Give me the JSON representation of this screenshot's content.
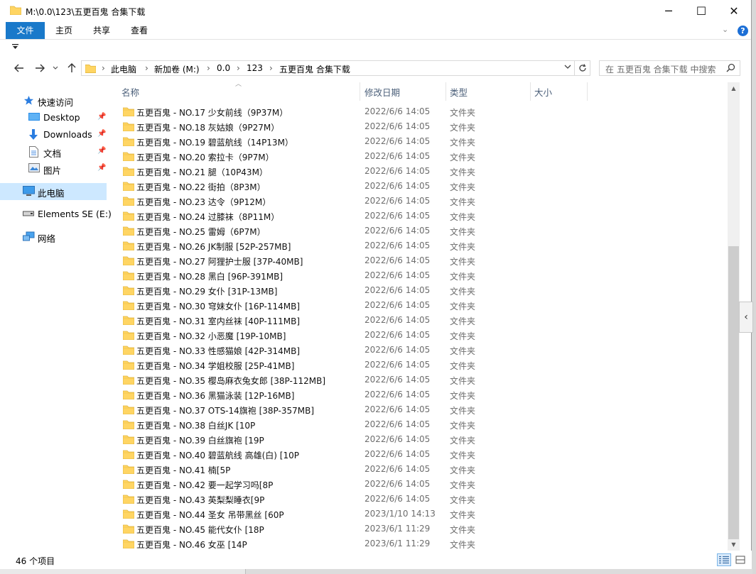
{
  "window": {
    "title": "M:\\0.0\\123\\五更百鬼 合集下载",
    "minimize_label": "─",
    "maximize_label": "☐",
    "close_label": "✕"
  },
  "ribbon": {
    "tabs": [
      "文件",
      "主页",
      "共享",
      "查看"
    ],
    "help_label": "?",
    "expand_label": "⌄"
  },
  "address": {
    "crumbs": [
      "此电脑",
      "新加卷 (M:)",
      "0.0",
      "123",
      "五更百鬼 合集下载"
    ],
    "search_placeholder": "在 五更百鬼 合集下载 中搜索"
  },
  "nav": {
    "quick_access": "快速访问",
    "items": [
      {
        "label": "Desktop",
        "pinned": true
      },
      {
        "label": "Downloads",
        "pinned": true
      },
      {
        "label": "文档",
        "pinned": true
      },
      {
        "label": "图片",
        "pinned": true
      }
    ],
    "this_pc": "此电脑",
    "drive": "Elements SE (E:)",
    "network": "网络"
  },
  "columns": {
    "name": "名称",
    "date": "修改日期",
    "type": "类型",
    "size": "大小"
  },
  "files": [
    {
      "name": "五更百鬼 - NO.17 少女前线（9P37M）",
      "date": "2022/6/6 14:05",
      "type": "文件夹"
    },
    {
      "name": "五更百鬼 - NO.18 灰姑娘（9P27M）",
      "date": "2022/6/6 14:05",
      "type": "文件夹"
    },
    {
      "name": "五更百鬼 - NO.19 碧蓝航线（14P13M）",
      "date": "2022/6/6 14:05",
      "type": "文件夹"
    },
    {
      "name": "五更百鬼 - NO.20 索拉卡（9P7M）",
      "date": "2022/6/6 14:05",
      "type": "文件夹"
    },
    {
      "name": "五更百鬼 - NO.21 腿（10P43M）",
      "date": "2022/6/6 14:05",
      "type": "文件夹"
    },
    {
      "name": "五更百鬼 - NO.22 街拍（8P3M）",
      "date": "2022/6/6 14:05",
      "type": "文件夹"
    },
    {
      "name": "五更百鬼 - NO.23 达令（9P12M）",
      "date": "2022/6/6 14:05",
      "type": "文件夹"
    },
    {
      "name": "五更百鬼 - NO.24 过膝袜（8P11M）",
      "date": "2022/6/6 14:05",
      "type": "文件夹"
    },
    {
      "name": "五更百鬼 - NO.25 雷姆（6P7M）",
      "date": "2022/6/6 14:05",
      "type": "文件夹"
    },
    {
      "name": "五更百鬼 - NO.26 JK制服 [52P-257MB]",
      "date": "2022/6/6 14:05",
      "type": "文件夹"
    },
    {
      "name": "五更百鬼 - NO.27 阿狸护士服 [37P-40MB]",
      "date": "2022/6/6 14:05",
      "type": "文件夹"
    },
    {
      "name": "五更百鬼 - NO.28 黑白 [96P-391MB]",
      "date": "2022/6/6 14:05",
      "type": "文件夹"
    },
    {
      "name": "五更百鬼 - NO.29 女仆 [31P-13MB]",
      "date": "2022/6/6 14:05",
      "type": "文件夹"
    },
    {
      "name": "五更百鬼 - NO.30 穹妹女仆 [16P-114MB]",
      "date": "2022/6/6 14:05",
      "type": "文件夹"
    },
    {
      "name": "五更百鬼 - NO.31 室内丝袜 [40P-111MB]",
      "date": "2022/6/6 14:05",
      "type": "文件夹"
    },
    {
      "name": "五更百鬼 - NO.32 小恶魔 [19P-10MB]",
      "date": "2022/6/6 14:05",
      "type": "文件夹"
    },
    {
      "name": "五更百鬼 - NO.33 性感猫娘 [42P-314MB]",
      "date": "2022/6/6 14:05",
      "type": "文件夹"
    },
    {
      "name": "五更百鬼 - NO.34 学姐校服 [25P-41MB]",
      "date": "2022/6/6 14:05",
      "type": "文件夹"
    },
    {
      "name": "五更百鬼 - NO.35 樱岛麻衣兔女郎 [38P-112MB]",
      "date": "2022/6/6 14:05",
      "type": "文件夹"
    },
    {
      "name": "五更百鬼 - NO.36 黑猫泳装 [12P-16MB]",
      "date": "2022/6/6 14:05",
      "type": "文件夹"
    },
    {
      "name": "五更百鬼 - NO.37 OTS-14旗袍 [38P-357MB]",
      "date": "2022/6/6 14:05",
      "type": "文件夹"
    },
    {
      "name": "五更百鬼 - NO.38 白丝JK [10P",
      "date": "2022/6/6 14:05",
      "type": "文件夹"
    },
    {
      "name": "五更百鬼 - NO.39 白丝旗袍 [19P",
      "date": "2022/6/6 14:05",
      "type": "文件夹"
    },
    {
      "name": "五更百鬼 - NO.40 碧蓝航线 高雄(白) [10P",
      "date": "2022/6/6 14:05",
      "type": "文件夹"
    },
    {
      "name": "五更百鬼 - NO.41 楠[5P",
      "date": "2022/6/6 14:05",
      "type": "文件夹"
    },
    {
      "name": "五更百鬼 - NO.42 要一起学习吗[8P",
      "date": "2022/6/6 14:05",
      "type": "文件夹"
    },
    {
      "name": "五更百鬼 - NO.43 英梨梨睡衣[9P",
      "date": "2022/6/6 14:05",
      "type": "文件夹"
    },
    {
      "name": "五更百鬼 - NO.44 圣女 吊带黑丝 [60P",
      "date": "2023/1/10 14:13",
      "type": "文件夹"
    },
    {
      "name": "五更百鬼 - NO.45 能代女仆 [18P",
      "date": "2023/6/1 11:29",
      "type": "文件夹"
    },
    {
      "name": "五更百鬼 - NO.46 女巫 [14P",
      "date": "2023/6/1 11:29",
      "type": "文件夹"
    }
  ],
  "status": {
    "item_count": "46 个项目"
  },
  "colors": {
    "accent": "#1979ca",
    "folder": "#ffd563",
    "selection": "#cde8ff"
  }
}
